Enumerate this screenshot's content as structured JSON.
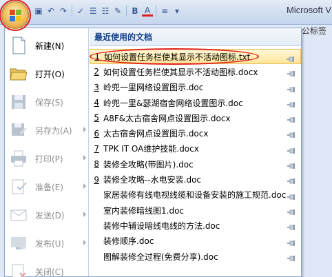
{
  "app_title": "Microsoft V",
  "ribbon_tag": "公标签",
  "qat_icons": [
    "save-icon",
    "undo-icon",
    "redo-icon",
    "spell-icon",
    "bullet-list-icon",
    "number-list-icon",
    "highlight-icon",
    "bold-icon",
    "font-color-icon",
    "align-icon",
    "dropdown-icon"
  ],
  "qat_glyphs": [
    "▣",
    "↶",
    "↷",
    "✓",
    "☰",
    "☷",
    "✎",
    "B",
    "A",
    "≡",
    "▾"
  ],
  "menu": {
    "commands": [
      {
        "label": "新建(N)",
        "icon": "new-document-icon",
        "disabled": false,
        "arrow": false
      },
      {
        "label": "打开(O)",
        "icon": "open-folder-icon",
        "disabled": false,
        "arrow": false
      },
      {
        "label": "保存(S)",
        "icon": "save-icon",
        "disabled": true,
        "arrow": false
      },
      {
        "label": "另存为(A)",
        "icon": "save-as-icon",
        "disabled": true,
        "arrow": true
      },
      {
        "label": "打印(P)",
        "icon": "print-icon",
        "disabled": true,
        "arrow": true
      },
      {
        "label": "准备(E)",
        "icon": "prepare-icon",
        "disabled": true,
        "arrow": true
      },
      {
        "label": "发送(D)",
        "icon": "send-icon",
        "disabled": true,
        "arrow": true
      },
      {
        "label": "发布(U)",
        "icon": "publish-icon",
        "disabled": true,
        "arrow": true
      },
      {
        "label": "关闭(C)",
        "icon": "close-document-icon",
        "disabled": true,
        "arrow": false
      }
    ],
    "recent_header": "最近使用的文档",
    "recent_docs": [
      {
        "num": "1",
        "name": "如何设置任务栏使其显示不活动图标.txt"
      },
      {
        "num": "2",
        "name": "如何设置任务栏使其显示不活动图标.docx"
      },
      {
        "num": "3",
        "name": "岭兜一里网络设置图示.doc"
      },
      {
        "num": "4",
        "name": "岭兜一里&瑟湖宿舍网络设置图示.doc"
      },
      {
        "num": "5",
        "name": "A8F&太古宿舍网点设置图示.docx"
      },
      {
        "num": "6",
        "name": "太古宿舍网点设置图示.docx"
      },
      {
        "num": "7",
        "name": "TPK IT OA维护技能.docx"
      },
      {
        "num": "8",
        "name": "装修全攻略(带图片).doc"
      },
      {
        "num": "9",
        "name": "装修全攻略--水电安装.doc"
      },
      {
        "num": "",
        "name": "家居装修有线电视线缆和设备安装的施工规范.doc"
      },
      {
        "num": "",
        "name": "室内装修暗线图1.doc"
      },
      {
        "num": "",
        "name": "装修中辅设暗线电线的方法.doc"
      },
      {
        "num": "",
        "name": "装修顺序.doc"
      },
      {
        "num": "",
        "name": "图解装修全过程(免费分享).doc"
      }
    ]
  },
  "colors": {
    "accent": "#15428b",
    "highlight": "#ffe59a",
    "annotation": "#e0201a"
  }
}
